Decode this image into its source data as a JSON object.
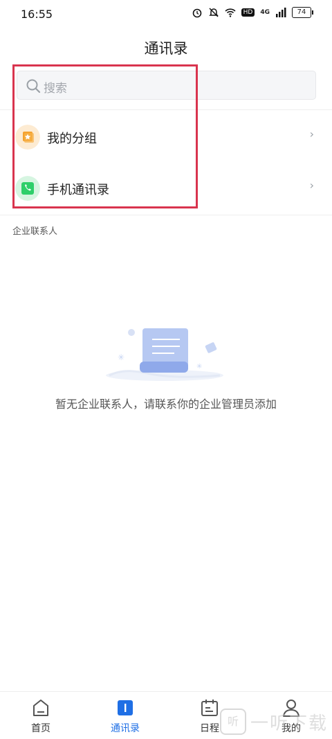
{
  "status": {
    "time": "16:55",
    "network": "4G",
    "hd": "HD",
    "battery": "74"
  },
  "header": {
    "title": "通讯录"
  },
  "search": {
    "placeholder": "搜索"
  },
  "rows": [
    {
      "label": "我的分组",
      "icon": "group-star-icon",
      "color": "#f4a12c"
    },
    {
      "label": "手机通讯录",
      "icon": "phone-icon",
      "color": "#2ecf6a"
    }
  ],
  "section": {
    "title": "企业联系人"
  },
  "empty": {
    "message": "暂无企业联系人，请联系你的企业管理员添加"
  },
  "tabs": [
    {
      "label": "首页",
      "icon": "home-icon"
    },
    {
      "label": "通讯录",
      "icon": "contacts-icon",
      "active": true
    },
    {
      "label": "日程",
      "icon": "calendar-icon"
    },
    {
      "label": "我的",
      "icon": "profile-icon"
    }
  ],
  "accent": "#1f6fe5",
  "highlight_color": "#d9344e",
  "watermark": {
    "badge": "听",
    "text": "一听下载"
  }
}
